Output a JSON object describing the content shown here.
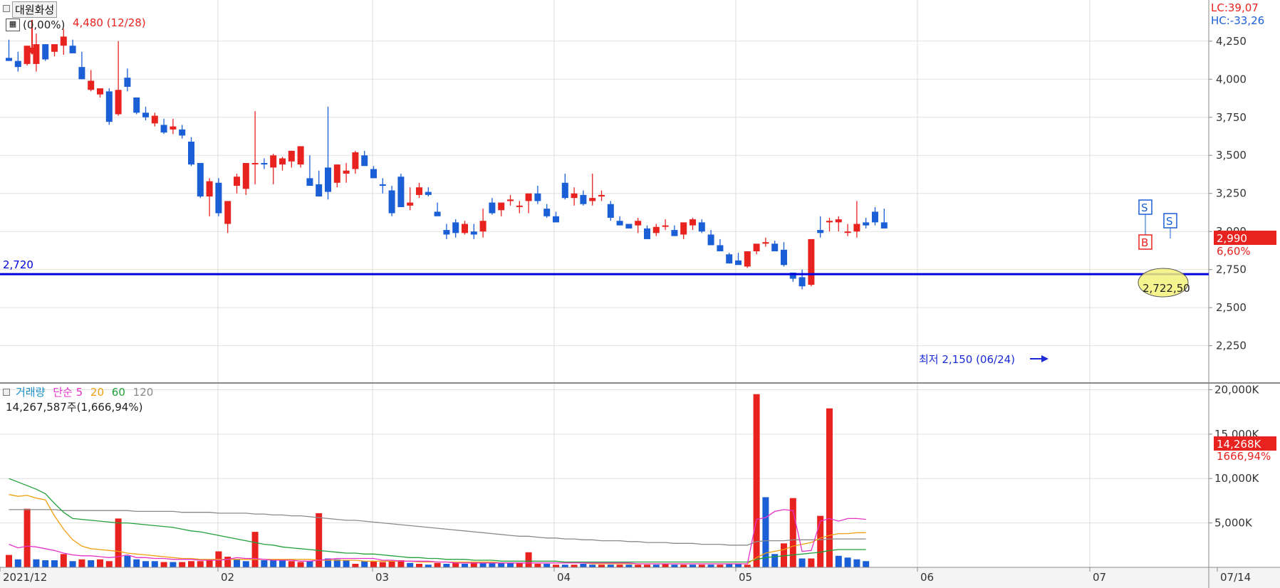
{
  "stock": {
    "name": "대원화성"
  },
  "indicators": {
    "lc": "LC:39,07",
    "hc": "HC:-33,26"
  },
  "price_panel": {
    "ratio_label": "(0,00%)",
    "high_label": "4,480 (12/28)",
    "low_label": "최저 2,150 (06/24)",
    "hline_label": "2,720",
    "current_price": "2,990",
    "current_change": "6,60%",
    "circle_label": "2,722,50"
  },
  "volume_panel": {
    "legend": {
      "volume": "거래량",
      "simple": "단순",
      "ma5": "5",
      "ma20": "20",
      "ma60": "60",
      "ma120": "120"
    },
    "current_volume_text": "14,267,587주(1,666,94%)",
    "current_volume_badge": "14,268K",
    "current_volume_pct": "1666,94%"
  },
  "colors": {
    "up": "#e8231f",
    "down": "#1b5fd6",
    "hline": "#0000dd",
    "ma5": "#e632c8",
    "ma20": "#f0a010",
    "ma60": "#21a03a",
    "ma120": "#8a8a8a"
  },
  "chart_data": {
    "type": "candlestick",
    "price_axis": {
      "ticks": [
        2250,
        2500,
        2750,
        3000,
        3250,
        3500,
        3750,
        4000,
        4250
      ],
      "tick_labels": [
        "2,250",
        "2,500",
        "2,750",
        "3,000",
        "3,250",
        "3,500",
        "3,750",
        "4,000",
        "4,250"
      ],
      "range": [
        2010,
        4450
      ]
    },
    "volume_axis": {
      "ticks": [
        5000,
        10000,
        15000,
        20000
      ],
      "tick_labels": [
        "5,000K",
        "10,000K",
        "15,000K",
        "20,000K"
      ],
      "range": [
        0,
        20600
      ],
      "unit": "K"
    },
    "x_labels": [
      "2021/12",
      "02",
      "03",
      "04",
      "05",
      "06",
      "07",
      "07/14"
    ],
    "horizontal_line": 2720,
    "annotations": {
      "high": 4480,
      "high_date": "12/28",
      "low": 2150,
      "low_date": "06/24",
      "signals": [
        {
          "type": "S",
          "at_index": 73
        },
        {
          "type": "B",
          "at_index": 73
        },
        {
          "type": "S",
          "at_index": 76
        }
      ]
    },
    "candles": [
      [
        4140,
        4260,
        4120,
        4120
      ],
      [
        4120,
        4180,
        4050,
        4080
      ],
      [
        4100,
        4220,
        4090,
        4220
      ],
      [
        4100,
        4300,
        4050,
        4230
      ],
      [
        4230,
        4230,
        4120,
        4130
      ],
      [
        4180,
        4230,
        4150,
        4230
      ],
      [
        4220,
        4330,
        4160,
        4280
      ],
      [
        4220,
        4260,
        4180,
        4170
      ],
      [
        4080,
        4180,
        4000,
        4000
      ],
      [
        3930,
        4060,
        3920,
        3990
      ],
      [
        3900,
        3940,
        3880,
        3940
      ],
      [
        3920,
        3940,
        3700,
        3720
      ],
      [
        3770,
        4250,
        3760,
        3930
      ],
      [
        4010,
        4070,
        3920,
        3950
      ],
      [
        3880,
        3880,
        3770,
        3780
      ],
      [
        3780,
        3820,
        3730,
        3750
      ],
      [
        3710,
        3780,
        3690,
        3760
      ],
      [
        3700,
        3740,
        3640,
        3650
      ],
      [
        3670,
        3740,
        3640,
        3690
      ],
      [
        3670,
        3700,
        3610,
        3630
      ],
      [
        3590,
        3620,
        3430,
        3440
      ],
      [
        3450,
        3450,
        3220,
        3230
      ],
      [
        3230,
        3350,
        3100,
        3330
      ],
      [
        3320,
        3350,
        3100,
        3120
      ],
      [
        3050,
        3200,
        2990,
        3200
      ],
      [
        3300,
        3380,
        3250,
        3360
      ],
      [
        3280,
        3440,
        3240,
        3450
      ],
      [
        3450,
        3790,
        3310,
        3450
      ],
      [
        3450,
        3480,
        3410,
        3440
      ],
      [
        3420,
        3510,
        3310,
        3500
      ],
      [
        3440,
        3490,
        3400,
        3480
      ],
      [
        3460,
        3530,
        3420,
        3530
      ],
      [
        3440,
        3560,
        3420,
        3560
      ],
      [
        3350,
        3500,
        3300,
        3300
      ],
      [
        3310,
        3400,
        3240,
        3230
      ],
      [
        3420,
        3820,
        3210,
        3260
      ],
      [
        3320,
        3440,
        3290,
        3440
      ],
      [
        3380,
        3450,
        3320,
        3400
      ],
      [
        3410,
        3530,
        3380,
        3520
      ],
      [
        3500,
        3530,
        3450,
        3430
      ],
      [
        3410,
        3430,
        3350,
        3350
      ],
      [
        3310,
        3350,
        3250,
        3300
      ],
      [
        3270,
        3300,
        3100,
        3120
      ],
      [
        3360,
        3380,
        3190,
        3160
      ],
      [
        3170,
        3290,
        3140,
        3190
      ],
      [
        3240,
        3320,
        3220,
        3290
      ],
      [
        3260,
        3290,
        3230,
        3240
      ],
      [
        3130,
        3190,
        3110,
        3100
      ],
      [
        3010,
        3050,
        2950,
        2980
      ],
      [
        3060,
        3080,
        2960,
        2990
      ],
      [
        2990,
        3070,
        2980,
        3050
      ],
      [
        3000,
        3050,
        2950,
        2980
      ],
      [
        3000,
        3150,
        2960,
        3070
      ],
      [
        3190,
        3220,
        3110,
        3120
      ],
      [
        3140,
        3170,
        3100,
        3190
      ],
      [
        3200,
        3240,
        3170,
        3210
      ],
      [
        3170,
        3200,
        3120,
        3170
      ],
      [
        3200,
        3230,
        3120,
        3250
      ],
      [
        3250,
        3300,
        3180,
        3200
      ],
      [
        3150,
        3180,
        3090,
        3100
      ],
      [
        3100,
        3130,
        3060,
        3060
      ],
      [
        3320,
        3380,
        3210,
        3220
      ],
      [
        3220,
        3290,
        3170,
        3250
      ],
      [
        3240,
        3270,
        3170,
        3180
      ],
      [
        3200,
        3380,
        3170,
        3220
      ],
      [
        3230,
        3270,
        3200,
        3240
      ],
      [
        3180,
        3200,
        3070,
        3090
      ],
      [
        3070,
        3100,
        3040,
        3040
      ],
      [
        3050,
        3050,
        3020,
        3020
      ],
      [
        3040,
        3090,
        2990,
        3070
      ],
      [
        3020,
        3040,
        2950,
        2950
      ],
      [
        2990,
        3050,
        2970,
        3030
      ],
      [
        3040,
        3080,
        3010,
        3040
      ],
      [
        3010,
        3040,
        2970,
        2970
      ],
      [
        2980,
        3030,
        2950,
        3060
      ],
      [
        3040,
        3090,
        3010,
        3080
      ],
      [
        3060,
        3080,
        2990,
        3000
      ],
      [
        2980,
        3010,
        2910,
        2910
      ],
      [
        2910,
        2950,
        2870,
        2870
      ],
      [
        2850,
        2860,
        2790,
        2790
      ],
      [
        2810,
        2860,
        2790,
        2780
      ],
      [
        2770,
        2870,
        2760,
        2870
      ],
      [
        2870,
        2910,
        2850,
        2920
      ],
      [
        2920,
        2960,
        2900,
        2930
      ],
      [
        2920,
        2940,
        2870,
        2870
      ],
      [
        2880,
        2930,
        2770,
        2780
      ],
      [
        2730,
        2730,
        2670,
        2690
      ],
      [
        2700,
        2750,
        2620,
        2640
      ],
      [
        2650,
        2950,
        2640,
        2950
      ],
      [
        3010,
        3100,
        2960,
        2990
      ],
      [
        3060,
        3090,
        3000,
        3070
      ],
      [
        3060,
        3100,
        3000,
        3080
      ],
      [
        3000,
        3050,
        2970,
        3000
      ],
      [
        3000,
        3200,
        2960,
        3050
      ],
      [
        3060,
        3090,
        3020,
        3040
      ],
      [
        3130,
        3160,
        3040,
        3060
      ],
      [
        3060,
        3150,
        3040,
        3020
      ]
    ],
    "volumes": [
      [
        1400,
        "up"
      ],
      [
        900,
        "down"
      ],
      [
        6600,
        "up"
      ],
      [
        900,
        "down"
      ],
      [
        800,
        "down"
      ],
      [
        800,
        "down"
      ],
      [
        1500,
        "up"
      ],
      [
        700,
        "down"
      ],
      [
        900,
        "up"
      ],
      [
        800,
        "down"
      ],
      [
        900,
        "up"
      ],
      [
        700,
        "up"
      ],
      [
        5500,
        "up"
      ],
      [
        1300,
        "down"
      ],
      [
        900,
        "down"
      ],
      [
        700,
        "down"
      ],
      [
        700,
        "down"
      ],
      [
        600,
        "up"
      ],
      [
        600,
        "down"
      ],
      [
        600,
        "up"
      ],
      [
        700,
        "up"
      ],
      [
        700,
        "up"
      ],
      [
        900,
        "up"
      ],
      [
        1800,
        "up"
      ],
      [
        1200,
        "up"
      ],
      [
        900,
        "down"
      ],
      [
        700,
        "down"
      ],
      [
        4000,
        "up"
      ],
      [
        800,
        "down"
      ],
      [
        800,
        "down"
      ],
      [
        900,
        "down"
      ],
      [
        700,
        "up"
      ],
      [
        600,
        "up"
      ],
      [
        700,
        "down"
      ],
      [
        6100,
        "up"
      ],
      [
        1000,
        "down"
      ],
      [
        900,
        "down"
      ],
      [
        800,
        "down"
      ],
      [
        400,
        "up"
      ],
      [
        700,
        "down"
      ],
      [
        700,
        "up"
      ],
      [
        600,
        "up"
      ],
      [
        700,
        "up"
      ],
      [
        800,
        "up"
      ],
      [
        500,
        "down"
      ],
      [
        400,
        "up"
      ],
      [
        300,
        "down"
      ],
      [
        500,
        "up"
      ],
      [
        400,
        "down"
      ],
      [
        500,
        "up"
      ],
      [
        400,
        "down"
      ],
      [
        600,
        "up"
      ],
      [
        500,
        "down"
      ],
      [
        500,
        "down"
      ],
      [
        500,
        "down"
      ],
      [
        500,
        "down"
      ],
      [
        500,
        "up"
      ],
      [
        1700,
        "up"
      ],
      [
        400,
        "up"
      ],
      [
        400,
        "down"
      ],
      [
        300,
        "up"
      ],
      [
        300,
        "down"
      ],
      [
        300,
        "up"
      ],
      [
        400,
        "down"
      ],
      [
        300,
        "down"
      ],
      [
        300,
        "up"
      ],
      [
        300,
        "down"
      ],
      [
        300,
        "up"
      ],
      [
        300,
        "down"
      ],
      [
        300,
        "up"
      ],
      [
        300,
        "up"
      ],
      [
        300,
        "down"
      ],
      [
        400,
        "up"
      ],
      [
        300,
        "down"
      ],
      [
        300,
        "up"
      ],
      [
        300,
        "down"
      ],
      [
        300,
        "up"
      ],
      [
        300,
        "down"
      ],
      [
        300,
        "up"
      ],
      [
        400,
        "down"
      ],
      [
        400,
        "down"
      ],
      [
        300,
        "up"
      ],
      [
        19500,
        "up"
      ],
      [
        7900,
        "down"
      ],
      [
        1500,
        "down"
      ],
      [
        2700,
        "up"
      ],
      [
        7800,
        "up"
      ],
      [
        1000,
        "down"
      ],
      [
        1000,
        "up"
      ],
      [
        5800,
        "up"
      ],
      [
        17900,
        "up"
      ],
      [
        1300,
        "down"
      ],
      [
        1100,
        "down"
      ],
      [
        900,
        "down"
      ],
      [
        700,
        "down"
      ]
    ],
    "moving_averages": {
      "ma5": [
        2600,
        2200,
        2400,
        2300,
        2100,
        1900,
        1600,
        1400,
        1300,
        1300,
        1200,
        1100,
        1200,
        1400,
        1100,
        1100,
        1000,
        1000,
        900,
        900,
        900,
        800,
        800,
        800,
        900,
        1100,
        1000,
        1000,
        900,
        800,
        800,
        800,
        700,
        700,
        800,
        900,
        1000,
        1000,
        1000,
        1000,
        1000,
        800,
        800,
        700,
        700,
        700,
        700,
        600,
        600,
        500,
        500,
        500,
        500,
        500,
        500,
        500,
        500,
        500,
        500,
        500,
        500,
        500,
        500,
        500,
        500,
        500,
        500,
        500,
        500,
        400,
        400,
        400,
        400,
        400,
        400,
        400,
        400,
        400,
        400,
        400,
        400,
        400,
        5400,
        5600,
        6300,
        6500,
        6400,
        1800,
        1900,
        5200,
        5500,
        5200,
        5500,
        5500,
        5400
      ],
      "ma20": [
        8200,
        8000,
        8100,
        7800,
        7600,
        5800,
        4300,
        3100,
        2400,
        2100,
        2000,
        1900,
        1800,
        1600,
        1500,
        1400,
        1300,
        1200,
        1100,
        1000,
        1000,
        900,
        900,
        900,
        900,
        900,
        900,
        900,
        900,
        900,
        900,
        900,
        900,
        900,
        800,
        800,
        800,
        800,
        800,
        700,
        700,
        700,
        700,
        700,
        700,
        600,
        600,
        600,
        600,
        600,
        600,
        600,
        600,
        600,
        500,
        500,
        500,
        500,
        500,
        500,
        500,
        500,
        500,
        500,
        400,
        400,
        400,
        400,
        400,
        400,
        400,
        400,
        400,
        400,
        400,
        400,
        400,
        400,
        400,
        400,
        400,
        400,
        1100,
        1600,
        1800,
        2000,
        2400,
        2600,
        2800,
        3300,
        3600,
        3800,
        3800,
        3900,
        3900
      ],
      "ma60": [
        10000,
        9600,
        9200,
        8800,
        8300,
        7200,
        6200,
        5500,
        5400,
        5300,
        5200,
        5100,
        5000,
        5000,
        4900,
        4800,
        4700,
        4600,
        4500,
        4300,
        4100,
        4000,
        3800,
        3600,
        3400,
        3200,
        3000,
        2800,
        2600,
        2500,
        2300,
        2200,
        2100,
        2000,
        1900,
        1800,
        1700,
        1600,
        1600,
        1500,
        1500,
        1400,
        1300,
        1200,
        1100,
        1100,
        1000,
        1000,
        900,
        900,
        900,
        800,
        800,
        800,
        700,
        700,
        700,
        700,
        700,
        700,
        700,
        600,
        600,
        600,
        600,
        600,
        600,
        600,
        600,
        600,
        600,
        600,
        600,
        600,
        600,
        600,
        600,
        600,
        600,
        600,
        600,
        600,
        900,
        1100,
        1200,
        1300,
        1400,
        1500,
        1600,
        1700,
        1900,
        2000,
        2000,
        2000,
        2000
      ],
      "ma120": [
        6500,
        6500,
        6500,
        6500,
        6500,
        6500,
        6400,
        6400,
        6400,
        6400,
        6400,
        6400,
        6400,
        6400,
        6300,
        6300,
        6300,
        6300,
        6300,
        6200,
        6200,
        6200,
        6200,
        6100,
        6100,
        6100,
        6100,
        6000,
        6000,
        5900,
        5900,
        5800,
        5800,
        5700,
        5600,
        5500,
        5400,
        5300,
        5300,
        5200,
        5100,
        5000,
        4900,
        4800,
        4700,
        4600,
        4500,
        4400,
        4300,
        4200,
        4100,
        4000,
        3900,
        3800,
        3700,
        3600,
        3500,
        3500,
        3400,
        3300,
        3300,
        3200,
        3200,
        3100,
        3100,
        3000,
        3000,
        3000,
        2900,
        2900,
        2800,
        2800,
        2800,
        2700,
        2700,
        2700,
        2600,
        2600,
        2600,
        2500,
        2500,
        2500,
        2900,
        3000,
        3000,
        3000,
        3100,
        3100,
        3100,
        3100,
        3200,
        3200,
        3200,
        3200,
        3200
      ]
    }
  }
}
